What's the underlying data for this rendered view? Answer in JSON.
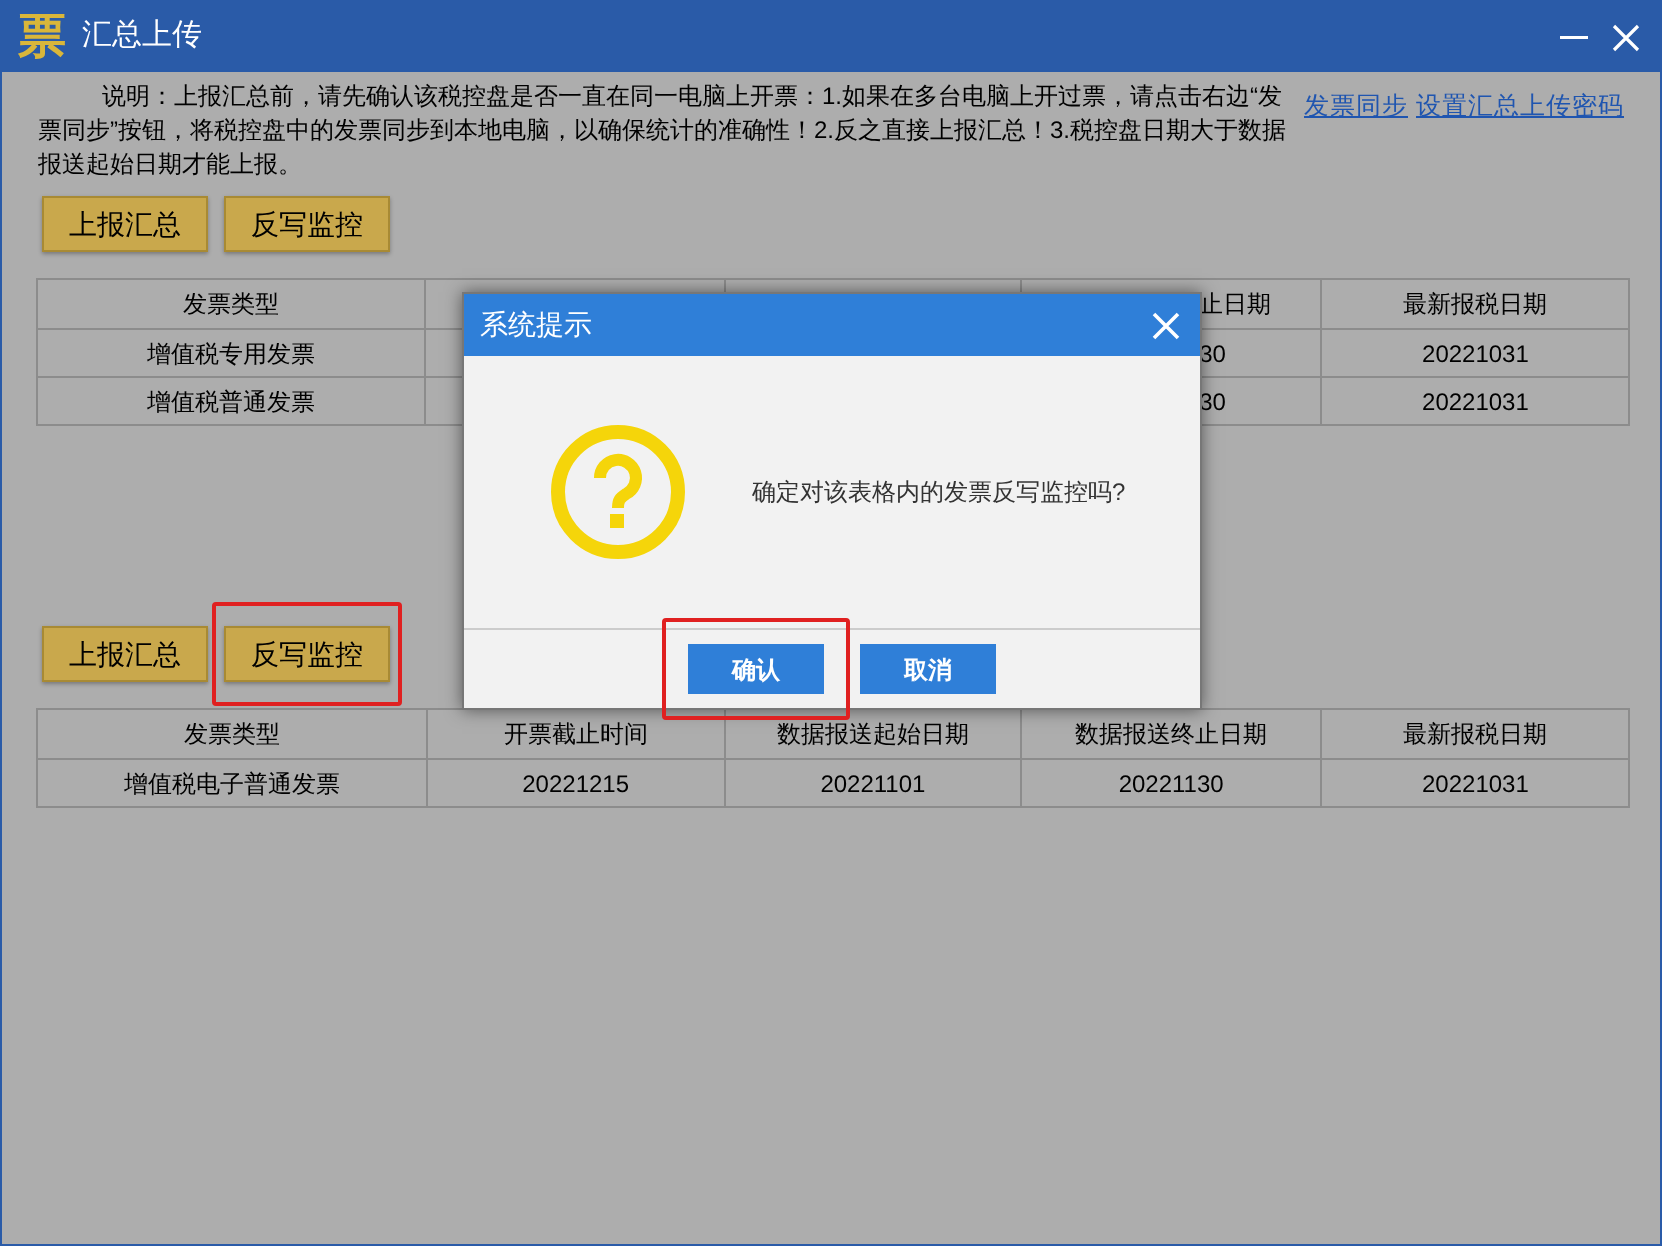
{
  "window": {
    "icon_text": "票",
    "title": "汇总上传"
  },
  "notice": {
    "text": "说明：上报汇总前，请先确认该税控盘是否一直在同一电脑上开票：1.如果在多台电脑上开过票，请点击右边“发票同步”按钮，将税控盘中的发票同步到本地电脑，以确保统计的准确性！2.反之直接上报汇总！3.税控盘日期大于数据报送起始日期才能上报。",
    "links": [
      "发票同步",
      "设置汇总上传密码"
    ]
  },
  "section_1": {
    "buttons": [
      {
        "label": "上报汇总",
        "highlighted": false
      },
      {
        "label": "反写监控",
        "highlighted": false
      }
    ],
    "table": {
      "columns": [
        "发票类型",
        null,
        null,
        "止日期",
        "最新报税日期"
      ],
      "rows": [
        [
          "增值税专用发票",
          null,
          null,
          "30",
          "20221031"
        ],
        [
          "增值税普通发票",
          null,
          null,
          "30",
          "20221031"
        ]
      ]
    }
  },
  "section_2": {
    "buttons": [
      {
        "label": "上报汇总",
        "highlighted": false
      },
      {
        "label": "反写监控",
        "highlighted": true
      }
    ],
    "table": {
      "columns": [
        "发票类型",
        "开票截止时间",
        "数据报送起始日期",
        "数据报送终止日期",
        "最新报税日期"
      ],
      "rows": [
        [
          "增值税电子普通发票",
          "20221215",
          "20221101",
          "20221130",
          "20221031"
        ]
      ]
    }
  },
  "dialog": {
    "title": "系统提示",
    "message": "确定对该表格内的发票反写监控吗?",
    "buttons": [
      {
        "label": "确认",
        "highlighted": true
      },
      {
        "label": "取消",
        "highlighted": false
      }
    ]
  }
}
